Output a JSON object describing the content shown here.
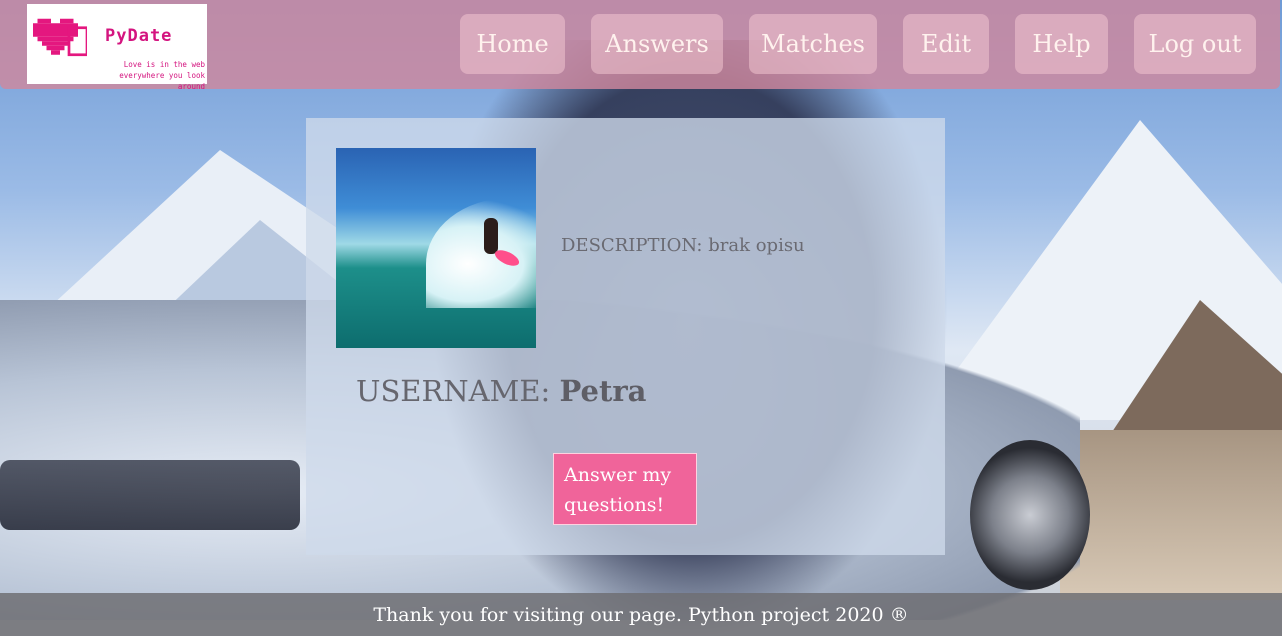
{
  "logo": {
    "name": "PyDate",
    "tagline_1": "Love is in the web",
    "tagline_2": "everywhere you look around",
    "brand_color": "#d4147f"
  },
  "nav": {
    "items": [
      {
        "label": "Home"
      },
      {
        "label": "Answers"
      },
      {
        "label": "Matches"
      },
      {
        "label": "Edit"
      },
      {
        "label": "Help"
      },
      {
        "label": "Log out"
      }
    ]
  },
  "profile": {
    "description": "DESCRIPTION: brak opisu",
    "username_label": "USERNAME:",
    "username_value": "Petra",
    "answer_button": "Answer my questions!"
  },
  "footer": {
    "text": "Thank you for visiting our page. Python project 2020 ®"
  },
  "colors": {
    "header_bg": "#ce879e",
    "button_pink": "#f0649a"
  }
}
